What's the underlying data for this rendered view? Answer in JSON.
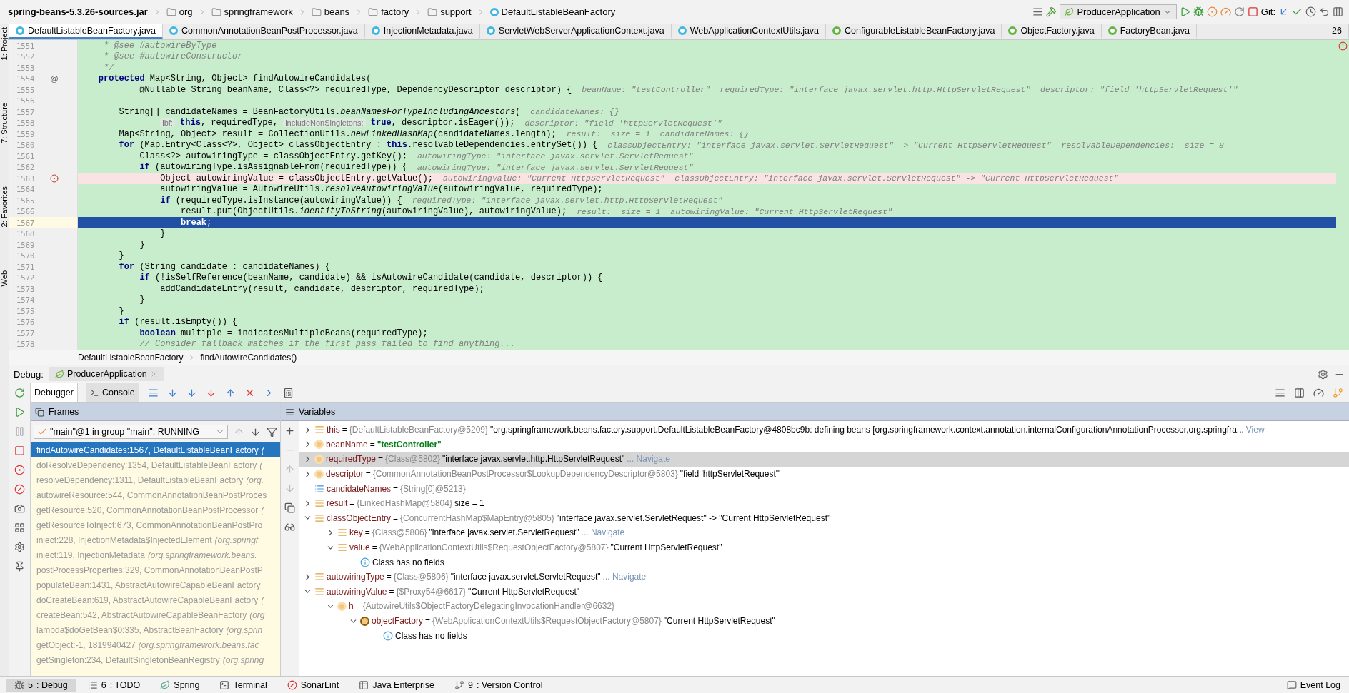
{
  "nav_bar": {
    "crumbs": [
      {
        "kind": "jar",
        "label": "spring-beans-5.3.26-sources.jar"
      },
      {
        "kind": "package",
        "label": "org"
      },
      {
        "kind": "package",
        "label": "springframework"
      },
      {
        "kind": "package",
        "label": "beans"
      },
      {
        "kind": "package",
        "label": "factory"
      },
      {
        "kind": "package",
        "label": "support"
      },
      {
        "kind": "class",
        "label": "DefaultListableBeanFactory"
      }
    ],
    "run_config": "ProducerApplication",
    "vcs_label": "Git:"
  },
  "side_strip": [
    "1: Project",
    "7: Structure",
    "2: Favorites",
    "Web"
  ],
  "editor_tabs": [
    {
      "kind": "class",
      "label": "DefaultListableBeanFactory.java",
      "selected": true
    },
    {
      "kind": "class",
      "label": "CommonAnnotationBeanPostProcessor.java",
      "selected": false
    },
    {
      "kind": "class",
      "label": "InjectionMetadata.java",
      "selected": false
    },
    {
      "kind": "class",
      "label": "ServletWebServerApplicationContext.java",
      "selected": false
    },
    {
      "kind": "class",
      "label": "WebApplicationContextUtils.java",
      "selected": false
    },
    {
      "kind": "interface",
      "label": "ConfigurableListableBeanFactory.java",
      "selected": false
    },
    {
      "kind": "interface",
      "label": "ObjectFactory.java",
      "selected": false
    },
    {
      "kind": "interface",
      "label": "FactoryBean.java",
      "selected": false
    }
  ],
  "tab_overflow": "26",
  "code_lines": [
    {
      "number": "1551",
      "kind": "comment",
      "code": "     * @see #autowireByType"
    },
    {
      "number": "1552",
      "kind": "comment",
      "code": "     * @see #autowireConstructor"
    },
    {
      "number": "1553",
      "kind": "comment",
      "code": "     */"
    },
    {
      "number": "1554",
      "kind": "code",
      "gutter": "@",
      "code": "    **protected** Map<String, Object> findAutowireCandidates("
    },
    {
      "number": "1555",
      "kind": "code",
      "code": "            @Nullable String beanName, Class<?> requiredType, DependencyDescriptor descriptor) {",
      "hint": "beanName: \"testController\"  requiredType: \"interface javax.servlet.http.HttpServletRequest\"  descriptor: \"field 'httpServletRequest'\""
    },
    {
      "number": "1556",
      "kind": "code"
    },
    {
      "number": "1557",
      "kind": "code",
      "code": "        String[] candidateNames = BeanFactoryUtils.*beanNamesForTypeIncludingAncestors*(",
      "hint": "candidateNames: {}"
    },
    {
      "number": "1558",
      "kind": "code",
      "segments": [
        {
          "kind": "param",
          "text": "lbf:"
        },
        {
          "kind": "code",
          "text": " **this**, requiredType, "
        },
        {
          "kind": "param",
          "text": "includeNonSingletons:"
        },
        {
          "kind": "code",
          "text": " **true**, descriptor.isEager());"
        }
      ],
      "hint": "descriptor: \"field 'httpServletRequest'\""
    },
    {
      "number": "1559",
      "kind": "code",
      "code": "        Map<String, Object> result = CollectionUtils.*newLinkedHashMap*(candidateNames.length);",
      "hint": "result:  size = 1  candidateNames: {}"
    },
    {
      "number": "1560",
      "kind": "code",
      "code": "        **for** (Map.Entry<Class<?>, Object> classObjectEntry : **this**.resolvableDependencies.entrySet()) {",
      "hint": "classObjectEntry: \"interface javax.servlet.ServletRequest\" -> \"Current HttpServletRequest\"  resolvableDependencies:  size = 8"
    },
    {
      "number": "1561",
      "kind": "code",
      "code": "            Class<?> autowiringType = classObjectEntry.getKey();",
      "hint": "autowiringType: \"interface javax.servlet.ServletRequest\""
    },
    {
      "number": "1562",
      "kind": "code",
      "code": "            **if** (autowiringType.isAssignableFrom(requiredType)) {",
      "hint": "autowiringType: \"interface javax.servlet.ServletRequest\""
    },
    {
      "number": "1563",
      "kind": "breakpoint",
      "code": "                Object autowiringValue = classObjectEntry.getValue();",
      "hint": "autowiringValue: \"Current HttpServletRequest\"  classObjectEntry: \"interface javax.servlet.ServletRequest\" -> \"Current HttpServletRequest\""
    },
    {
      "number": "1564",
      "kind": "code",
      "code": "                autowiringValue = AutowireUtils.*resolveAutowiringValue*(autowiringValue, requiredType);"
    },
    {
      "number": "1565",
      "kind": "code",
      "code": "                **if** (requiredType.isInstance(autowiringValue)) {",
      "hint": "requiredType: \"interface javax.servlet.http.HttpServletRequest\""
    },
    {
      "number": "1566",
      "kind": "code",
      "code": "                    result.put(ObjectUtils.*identityToString*(autowiringValue), autowiringValue);",
      "hint": "result:  size = 1  autowiringValue: \"Current HttpServletRequest\""
    },
    {
      "number": "1567",
      "kind": "execution",
      "code": "                    **break**;"
    },
    {
      "number": "1568",
      "kind": "code",
      "code": "                }"
    },
    {
      "number": "1569",
      "kind": "code",
      "code": "            }"
    },
    {
      "number": "1570",
      "kind": "code",
      "code": "        }"
    },
    {
      "number": "1571",
      "kind": "code",
      "code": "        **for** (String candidate : candidateNames) {"
    },
    {
      "number": "1572",
      "kind": "code",
      "code": "            **if** (!isSelfReference(beanName, candidate) && isAutowireCandidate(candidate, descriptor)) {"
    },
    {
      "number": "1573",
      "kind": "code",
      "code": "                addCandidateEntry(result, candidate, descriptor, requiredType);"
    },
    {
      "number": "1574",
      "kind": "code",
      "code": "            }"
    },
    {
      "number": "1575",
      "kind": "code",
      "code": "        }"
    },
    {
      "number": "1576",
      "kind": "code",
      "code": "        **if** (result.isEmpty()) {"
    },
    {
      "number": "1577",
      "kind": "code",
      "code": "            **boolean** multiple = indicatesMultipleBeans(requiredType);"
    },
    {
      "number": "1578",
      "kind": "comment",
      "code": "            // Consider fallback matches if the first pass failed to find anything..."
    }
  ],
  "editor_breadcrumbs": [
    "DefaultListableBeanFactory",
    "findAutowireCandidates()"
  ],
  "debug": {
    "label": "Debug:",
    "session": "ProducerApplication",
    "tabs": [
      {
        "label": "Debugger",
        "selected": true
      },
      {
        "label": "Console",
        "selected": false
      }
    ],
    "frames_title": "Frames",
    "thread": "\"main\"@1 in group \"main\": RUNNING",
    "frames": [
      {
        "method": "findAutowireCandidates:1567, DefaultListableBeanFactory",
        "package": "(",
        "selected": true
      },
      {
        "method": "doResolveDependency:1354, DefaultListableBeanFactory",
        "package": "(",
        "selected": false
      },
      {
        "method": "resolveDependency:1311, DefaultListableBeanFactory",
        "package": "(org.",
        "selected": false
      },
      {
        "method": "autowireResource:544, CommonAnnotationBeanPostProces",
        "selected": false
      },
      {
        "method": "getResource:520, CommonAnnotationBeanPostProcessor",
        "package": "(",
        "selected": false
      },
      {
        "method": "getResourceToInject:673, CommonAnnotationBeanPostPro",
        "selected": false
      },
      {
        "method": "inject:228, InjectionMetadata$InjectedElement",
        "package": "(org.springf",
        "selected": false
      },
      {
        "method": "inject:119, InjectionMetadata",
        "package": "(org.springframework.beans.",
        "selected": false
      },
      {
        "method": "postProcessProperties:329, CommonAnnotationBeanPostP",
        "selected": false
      },
      {
        "method": "populateBean:1431, AbstractAutowireCapableBeanFactory",
        "selected": false
      },
      {
        "method": "doCreateBean:619, AbstractAutowireCapableBeanFactory",
        "package": "(",
        "selected": false
      },
      {
        "method": "createBean:542, AbstractAutowireCapableBeanFactory",
        "package": "(org",
        "selected": false
      },
      {
        "method": "lambda$doGetBean$0:335, AbstractBeanFactory",
        "package": "(org.sprin",
        "selected": false
      },
      {
        "method": "getObject:-1, 1819940427",
        "package": "(org.springframework.beans.fac",
        "selected": false
      },
      {
        "method": "getSingleton:234, DefaultSingletonBeanRegistry",
        "package": "(org.spring",
        "selected": false
      }
    ],
    "variables_title": "Variables",
    "variables": [
      {
        "kind": "local",
        "name": "this",
        "equals": "=",
        "type": "{DefaultListableBeanFactory@5209}",
        "value": "\"org.springframework.beans.factory.support.DefaultListableBeanFactory@4808bc9b: defining beans [org.springframework.context.annotation.internalConfigurationAnnotationProcessor,org.springfra...",
        "link": "View",
        "expanded": false,
        "selected": false
      },
      {
        "kind": "param",
        "name": "beanName",
        "equals": "=",
        "value": "\"testController\"",
        "expanded": false,
        "selected": false
      },
      {
        "kind": "param",
        "name": "requiredType",
        "equals": "=",
        "type": "{Class@5802}",
        "value": "\"interface javax.servlet.http.HttpServletRequest\"",
        "link": "... Navigate",
        "expanded": false,
        "selected": true
      },
      {
        "kind": "param",
        "name": "descriptor",
        "equals": "=",
        "type": "{CommonAnnotationBeanPostProcessor$LookupDependencyDescriptor@5803}",
        "value": "\"field 'httpServletRequest'\"",
        "expanded": false,
        "selected": false
      },
      {
        "kind": "array",
        "name": "candidateNames",
        "equals": "=",
        "type": "{String[0]@5213}",
        "selected": false
      },
      {
        "kind": "local",
        "name": "result",
        "equals": "=",
        "type": "{LinkedHashMap@5804}",
        "value": "size = 1",
        "expanded": false,
        "selected": false
      },
      {
        "kind": "local",
        "name": "classObjectEntry",
        "equals": "=",
        "type": "{ConcurrentHashMap$MapEntry@5805}",
        "value": "\"interface javax.servlet.ServletRequest\" -> \"Current HttpServletRequest\"",
        "expanded": true,
        "selected": false,
        "children": [
          {
            "kind": "local",
            "name": "key",
            "equals": "=",
            "type": "{Class@5806}",
            "value": "\"interface javax.servlet.ServletRequest\"",
            "link": "... Navigate",
            "expanded": false,
            "selected": false
          },
          {
            "kind": "local",
            "name": "value",
            "equals": "=",
            "type": "{WebApplicationContextUtils$RequestObjectFactory@5807}",
            "value": "\"Current HttpServletRequest\"",
            "expanded": true,
            "selected": false,
            "children": [
              {
                "kind": "info",
                "name": "Class has no fields",
                "selected": false
              }
            ]
          }
        ]
      },
      {
        "kind": "local",
        "name": "autowiringType",
        "equals": "=",
        "type": "{Class@5806}",
        "value": "\"interface javax.servlet.ServletRequest\"",
        "link": "... Navigate",
        "expanded": false,
        "selected": false
      },
      {
        "kind": "local",
        "name": "autowiringValue",
        "equals": "=",
        "type": "{$Proxy54@6617}",
        "value": "\"Current HttpServletRequest\"",
        "expanded": true,
        "selected": false,
        "children": [
          {
            "kind": "field",
            "name": "h",
            "equals": "=",
            "type": "{AutowireUtils$ObjectFactoryDelegatingInvocationHandler@6632}",
            "expanded": true,
            "selected": false,
            "children": [
              {
                "kind": "final_field",
                "name": "objectFactory",
                "equals": "=",
                "type": "{WebApplicationContextUtils$RequestObjectFactory@5807}",
                "value": "\"Current HttpServletRequest\"",
                "expanded": true,
                "selected": false,
                "children": [
                  {
                    "kind": "info",
                    "name": "Class has no fields",
                    "selected": false
                  }
                ]
              }
            ]
          }
        ]
      }
    ]
  },
  "tool_windows": [
    {
      "kind": "debug",
      "number": "5",
      "label": ": Debug",
      "selected": true
    },
    {
      "kind": "todo",
      "number": "6",
      "label": ": TODO",
      "selected": false
    },
    {
      "kind": "spring",
      "label": "Spring",
      "selected": false
    },
    {
      "kind": "terminal",
      "label": "Terminal",
      "selected": false
    },
    {
      "kind": "sonar",
      "label": "SonarLint",
      "selected": false
    },
    {
      "kind": "javaee",
      "label": "Java Enterprise",
      "selected": false
    },
    {
      "kind": "vcs",
      "number": "9",
      "label": ": Version Control",
      "selected": false
    }
  ],
  "event_log": "Event Log"
}
